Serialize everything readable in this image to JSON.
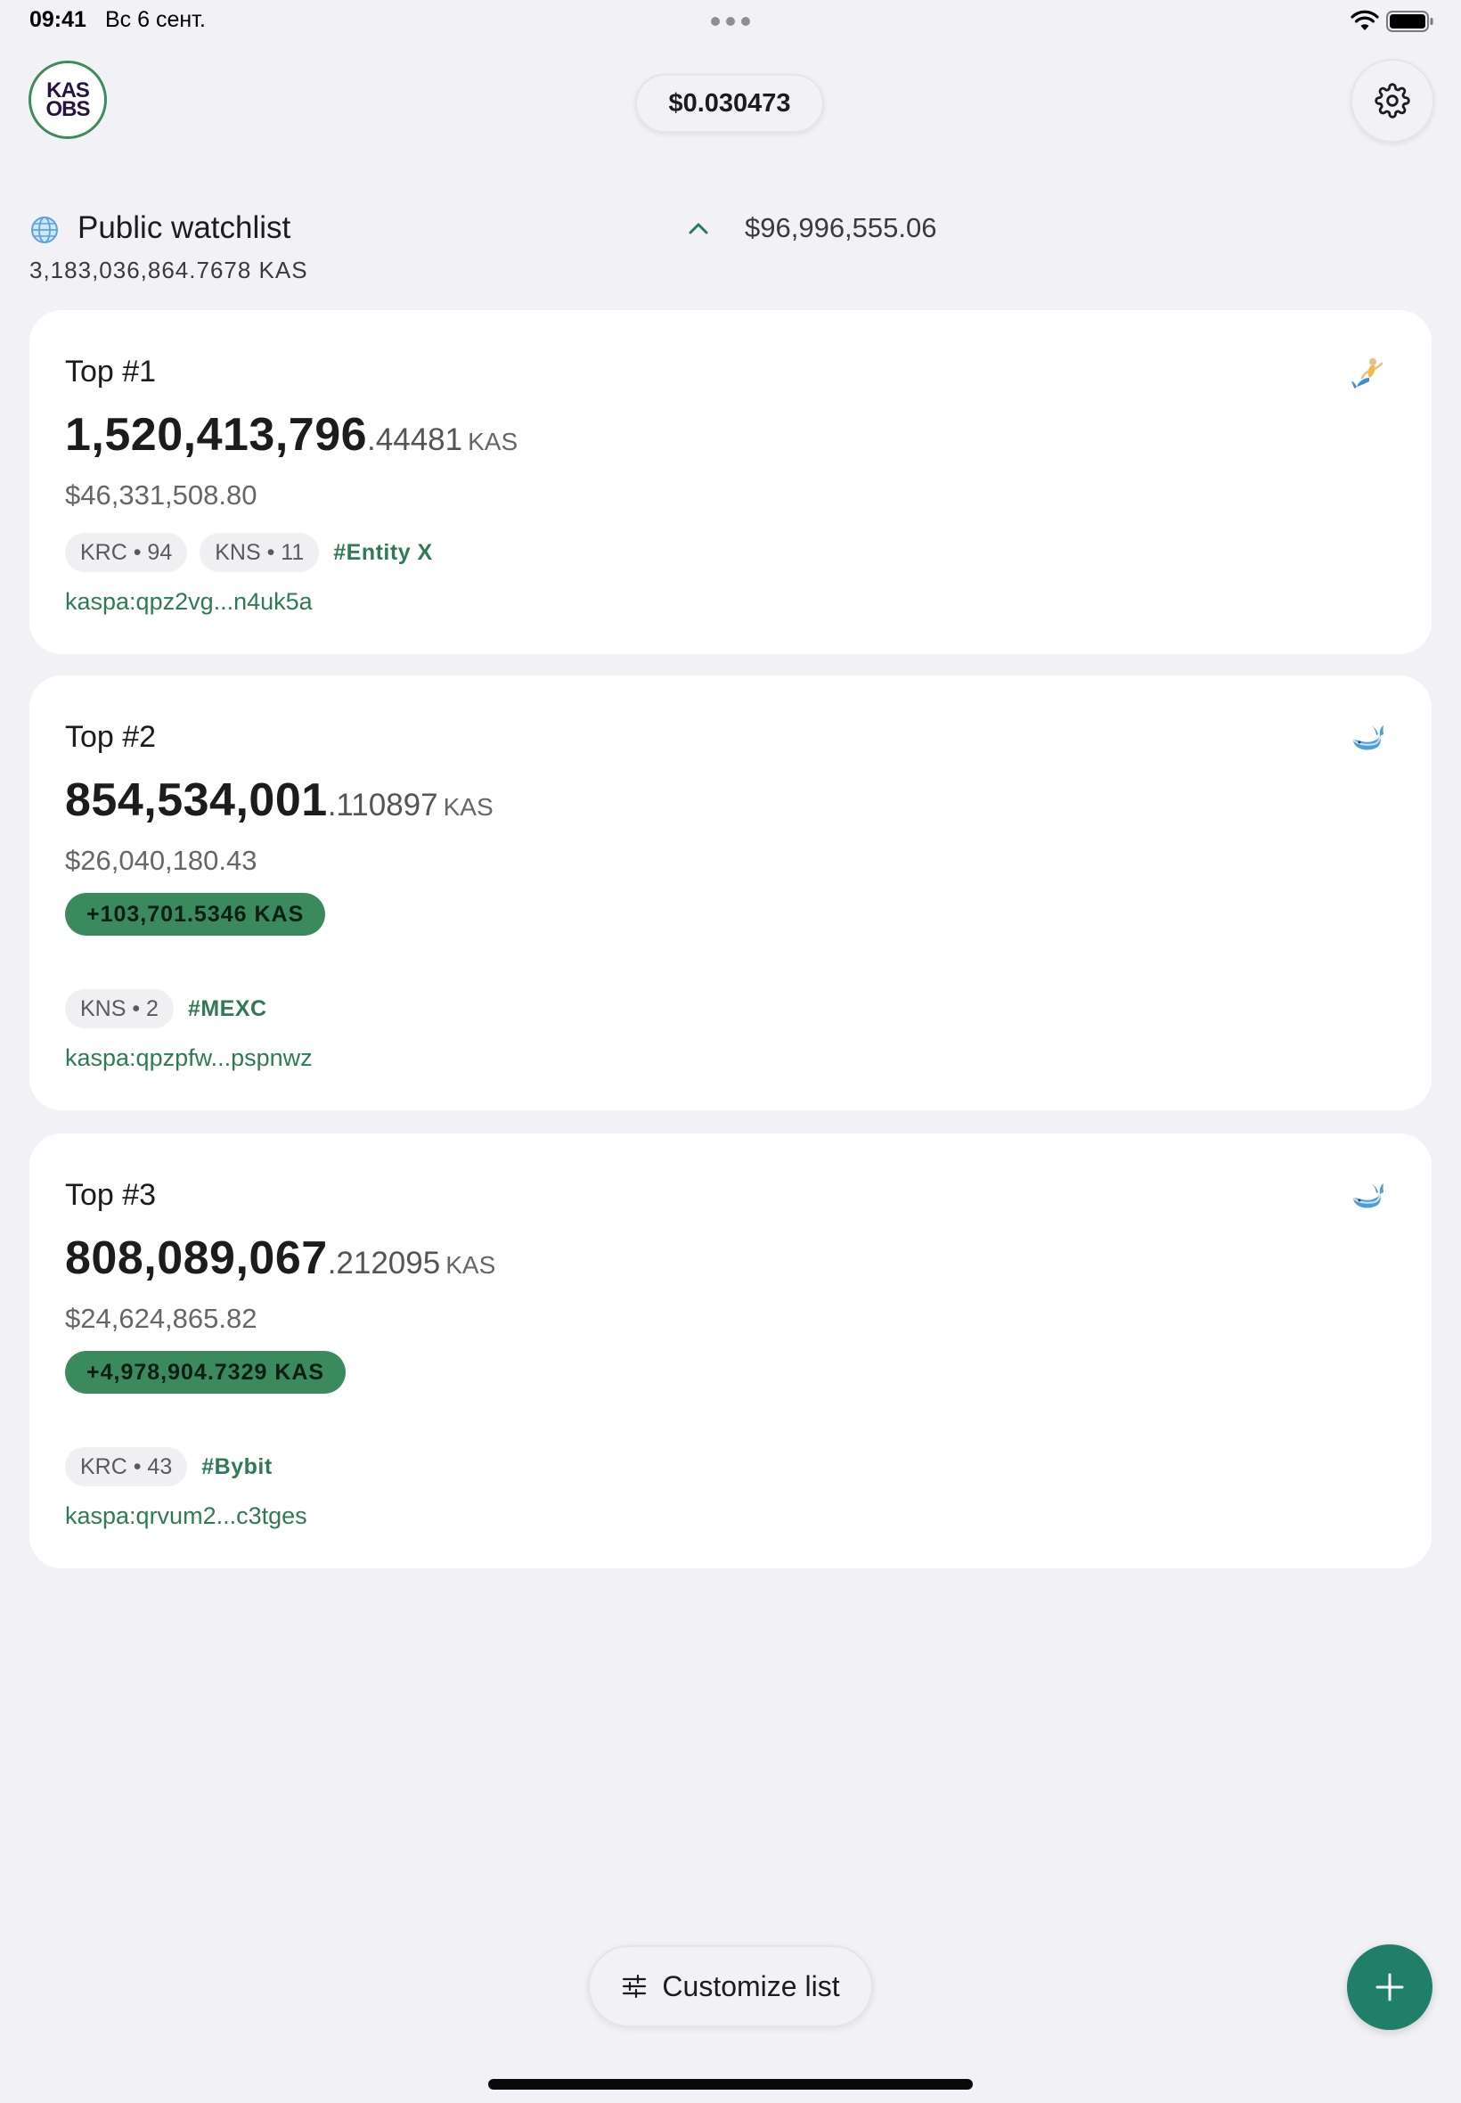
{
  "status_bar": {
    "time": "09:41",
    "date": "Вс 6 сент."
  },
  "header": {
    "logo_line1": "KAS",
    "logo_line2": "OBS",
    "price": "$0.030473"
  },
  "watchlist": {
    "title": "Public watchlist",
    "total_kas": "3,183,036,864.7678 KAS",
    "total_usd": "$96,996,555.06"
  },
  "cards": [
    {
      "title": "Top #1",
      "icon": "fish-icon",
      "balance_int": "1,520,413,796",
      "balance_dec": ".44481",
      "unit": "KAS",
      "usd": "$46,331,508.80",
      "tags": [
        "KRC • 94",
        "KNS • 11"
      ],
      "hashtag": "#Entity X",
      "address": "kaspa:qpz2vg...n4uk5a"
    },
    {
      "title": "Top #2",
      "icon": "whale-icon",
      "balance_int": "854,534,001",
      "balance_dec": ".110897",
      "unit": "KAS",
      "usd": "$26,040,180.43",
      "change": "+103,701.5346 KAS",
      "tags": [
        "KNS • 2"
      ],
      "hashtag": "#MEXC",
      "address": "kaspa:qpzpfw...pspnwz"
    },
    {
      "title": "Top #3",
      "icon": "whale-icon",
      "balance_int": "808,089,067",
      "balance_dec": ".212095",
      "unit": "KAS",
      "usd": "$24,624,865.82",
      "change": "+4,978,904.7329 KAS",
      "tags": [
        "KRC • 43"
      ],
      "hashtag": "#Bybit",
      "address": "kaspa:qrvum2...c3tges"
    }
  ],
  "bottom": {
    "customize_label": "Customize list"
  },
  "colors": {
    "accent_green": "#2f7a56",
    "pill_green": "#3b8a5e",
    "fab_teal": "#1f7f69",
    "background": "#f2f2f6"
  }
}
